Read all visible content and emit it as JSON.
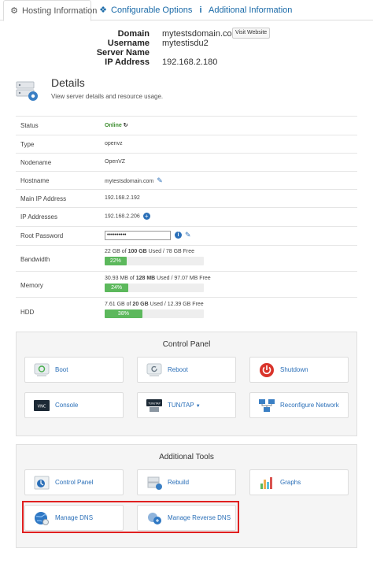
{
  "tabs": [
    {
      "label": "Hosting Information",
      "icon": "gear-icon"
    },
    {
      "label": "Configurable Options",
      "icon": "cubes-icon"
    },
    {
      "label": "Additional Information",
      "icon": "info-icon"
    }
  ],
  "server": {
    "domain_label": "Domain",
    "domain": "mytestsdomain.com",
    "visit_label": "Visit Website",
    "username_label": "Username",
    "username": "mytestisdu2",
    "server_name_label": "Server Name",
    "server_name": "",
    "ip_label": "IP Address",
    "ip": "192.168.2.180"
  },
  "details": {
    "title": "Details",
    "subtitle": "View server details and resource usage.",
    "rows": {
      "status": {
        "label": "Status",
        "value": "Online"
      },
      "type": {
        "label": "Type",
        "value": "openvz"
      },
      "nodename": {
        "label": "Nodename",
        "value": "OpenVZ"
      },
      "hostname": {
        "label": "Hostname",
        "value": "mytestsdomain.com"
      },
      "main_ip": {
        "label": "Main IP Address",
        "value": "192.168.2.192"
      },
      "ip_addresses": {
        "label": "IP Addresses",
        "value": "192.168.2.206"
      },
      "root_password": {
        "label": "Root Password",
        "value": "••••••••••"
      },
      "bandwidth": {
        "label": "Bandwidth",
        "used": "22 GB",
        "of": " of ",
        "total": "100 GB",
        "rest": " Used / 78 GB Free",
        "percent_label": "22%",
        "percent": 22
      },
      "memory": {
        "label": "Memory",
        "used": "30.93 MB",
        "of": " of ",
        "total": "128 MB",
        "rest": " Used / 97.07 MB Free",
        "percent_label": "24%",
        "percent": 24
      },
      "hdd": {
        "label": "HDD",
        "used": "7.61 GB",
        "of": " of ",
        "total": "20 GB",
        "rest": " Used / 12.39 GB Free",
        "percent_label": "38%",
        "percent": 38
      }
    }
  },
  "control_panel": {
    "title": "Control Panel",
    "buttons": {
      "boot": "Boot",
      "reboot": "Reboot",
      "shutdown": "Shutdown",
      "console": "Console",
      "tuntap": "TUN/TAP",
      "reconfigure": "Reconfigure Network"
    },
    "console_icon_text": "VNC",
    "tuntap_icon_text": "TUN/TAP"
  },
  "additional_tools": {
    "title": "Additional Tools",
    "buttons": {
      "control_panel": "Control Panel",
      "rebuild": "Rebuild",
      "graphs": "Graphs",
      "manage_dns": "Manage DNS",
      "manage_rdns": "Manage Reverse DNS"
    }
  },
  "colors": {
    "link": "#2a6fb8",
    "online": "#3c8d2f",
    "progress": "#5cb85c",
    "highlight": "#e02020",
    "shutdown": "#d9342b"
  }
}
